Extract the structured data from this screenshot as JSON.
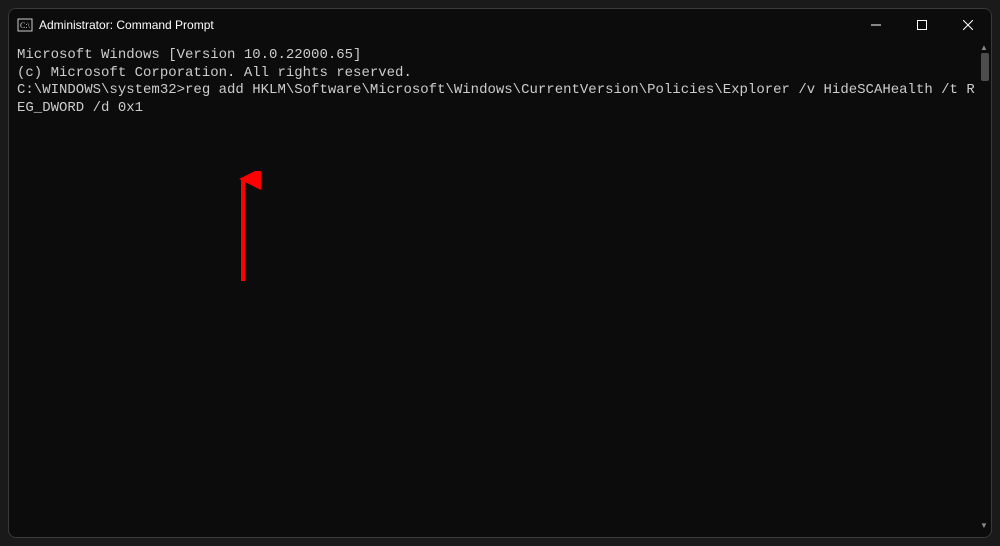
{
  "window": {
    "title": "Administrator: Command Prompt"
  },
  "terminal": {
    "line1": "Microsoft Windows [Version 10.0.22000.65]",
    "line2": "(c) Microsoft Corporation. All rights reserved.",
    "blank": "",
    "prompt_line": "C:\\WINDOWS\\system32>reg add HKLM\\Software\\Microsoft\\Windows\\CurrentVersion\\Policies\\Explorer /v HideSCAHealth /t REG_DWORD /d 0x1"
  },
  "annotation": {
    "color": "#ff0000"
  }
}
